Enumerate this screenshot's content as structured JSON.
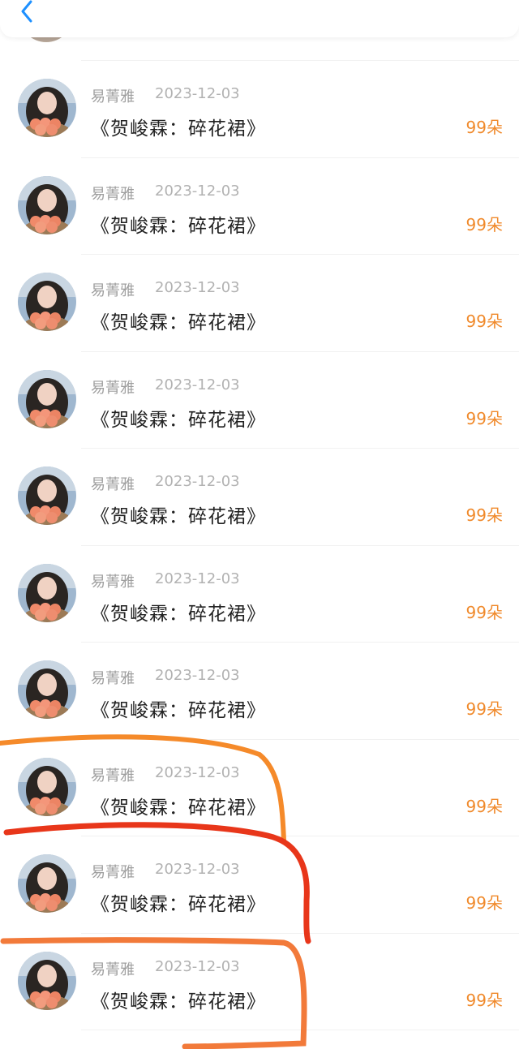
{
  "header": {
    "back_icon": "chevron-left-icon"
  },
  "colors": {
    "accent": "#1e90ff",
    "amount": "#f08a2c",
    "annotation_orange": "#f58a2a",
    "annotation_red": "#e8361a"
  },
  "records": [
    {
      "name": "易菁雅",
      "date": "2023-12-03",
      "title": "《贺峻霖：碎花裙》",
      "amount": "99朵"
    },
    {
      "name": "易菁雅",
      "date": "2023-12-03",
      "title": "《贺峻霖：碎花裙》",
      "amount": "99朵"
    },
    {
      "name": "易菁雅",
      "date": "2023-12-03",
      "title": "《贺峻霖：碎花裙》",
      "amount": "99朵"
    },
    {
      "name": "易菁雅",
      "date": "2023-12-03",
      "title": "《贺峻霖：碎花裙》",
      "amount": "99朵"
    },
    {
      "name": "易菁雅",
      "date": "2023-12-03",
      "title": "《贺峻霖：碎花裙》",
      "amount": "99朵"
    },
    {
      "name": "易菁雅",
      "date": "2023-12-03",
      "title": "《贺峻霖：碎花裙》",
      "amount": "99朵"
    },
    {
      "name": "易菁雅",
      "date": "2023-12-03",
      "title": "《贺峻霖：碎花裙》",
      "amount": "99朵"
    },
    {
      "name": "易菁雅",
      "date": "2023-12-03",
      "title": "《贺峻霖：碎花裙》",
      "amount": "99朵"
    },
    {
      "name": "易菁雅",
      "date": "2023-12-03",
      "title": "《贺峻霖：碎花裙》",
      "amount": "99朵"
    },
    {
      "name": "易菁雅",
      "date": "2023-12-03",
      "title": "《贺峻霖：碎花裙》",
      "amount": "99朵"
    }
  ]
}
